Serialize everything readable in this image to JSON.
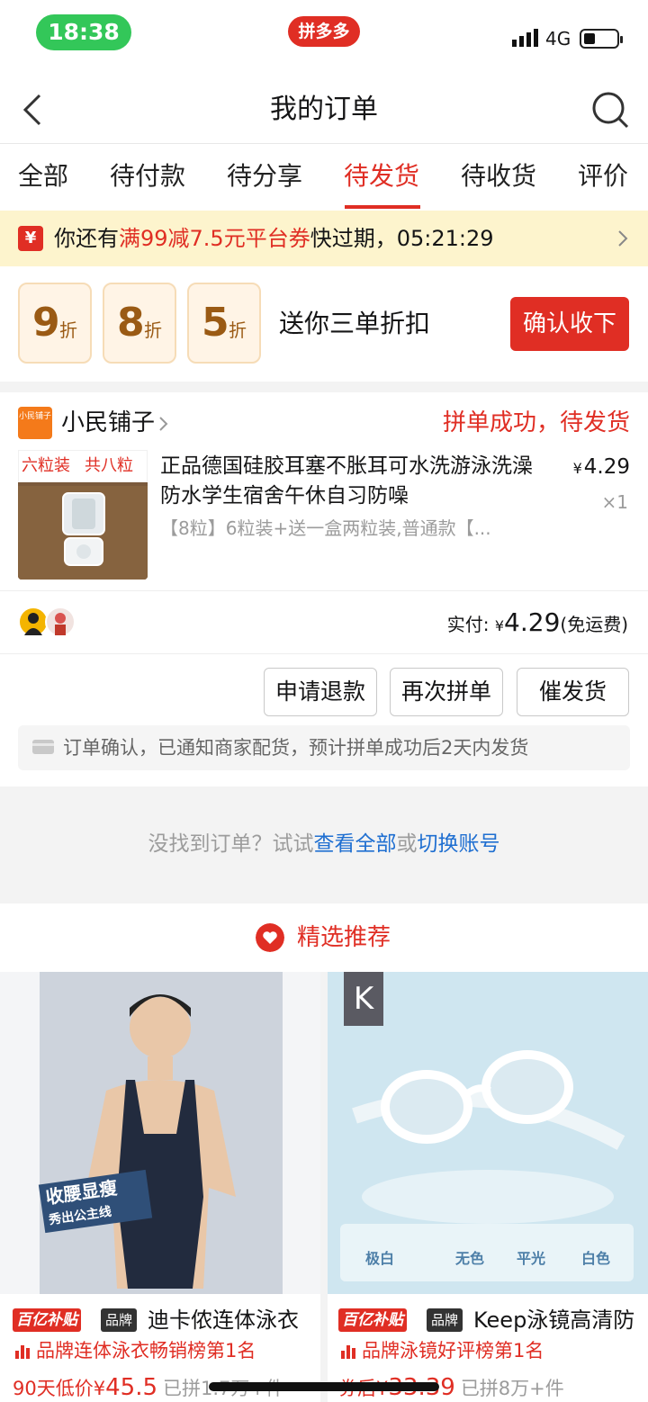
{
  "status_bar": {
    "time": "18:38",
    "app_name": "拼多多",
    "network": "4G"
  },
  "nav": {
    "title": "我的订单"
  },
  "tabs": [
    {
      "label": "全部"
    },
    {
      "label": "待付款"
    },
    {
      "label": "待分享"
    },
    {
      "label": "待发货",
      "active": true
    },
    {
      "label": "待收货"
    },
    {
      "label": "评价"
    }
  ],
  "coupon_banner": {
    "icon": "¥",
    "prefix": "你还有",
    "highlight": "满99减7.5元平台券",
    "suffix": "快过期，",
    "countdown": "05:21:29"
  },
  "discounts": {
    "cards": [
      {
        "num": "9",
        "unit": "折"
      },
      {
        "num": "8",
        "unit": "折"
      },
      {
        "num": "5",
        "unit": "折"
      }
    ],
    "label": "送你三单折扣",
    "button": "确认收下"
  },
  "order": {
    "shop_logo_text": "小民铺子",
    "shop_name": "小民铺子",
    "status": "拼单成功，待发货",
    "thumb_tags": [
      "六粒装",
      "共八粒"
    ],
    "product_title": "正品德国硅胶耳塞不胀耳可水洗游泳洗澡防水学生宿舍午休自习防噪",
    "price_symbol": "¥",
    "price": "4.29",
    "qty": "×1",
    "spec": "【8粒】6粒装+送一盒两粒装,普通款【...",
    "paid_label": "实付:",
    "paid_symbol": "¥",
    "paid_amount": "4.29",
    "shipping": "(免运费)",
    "buttons": {
      "refund": "申请退款",
      "reorder": "再次拼单",
      "urge": "催发货"
    },
    "notice": "订单确认，已通知商家配货，预计拼单成功后2天内发货"
  },
  "not_found": {
    "prefix": "没找到订单？试试",
    "link1": "查看全部",
    "mid": "或",
    "link2": "切换账号"
  },
  "recommend": {
    "title": "精选推荐",
    "products": [
      {
        "img_tag_line1": "收腰显瘦",
        "img_tag_line2": "秀出公主线",
        "subsidy_tag": "百亿补贴",
        "brand_tag": "品牌",
        "title": "迪卡侬连体泳衣",
        "rank": "品牌连体泳衣畅销榜第1名",
        "price_prefix": "90天低价",
        "price_symbol": "¥",
        "price": "45.5",
        "sold": "已拼1.7万+件"
      },
      {
        "logo": "K",
        "params": [
          "极白",
          "无色",
          "平光",
          "白色"
        ],
        "subsidy_tag": "百亿补贴",
        "brand_tag": "品牌",
        "title": "Keep泳镜高清防",
        "rank": "品牌泳镜好评榜第1名",
        "price_prefix": "券后",
        "price_symbol": "¥",
        "price": "33.39",
        "sold": "已拼8万+件"
      }
    ]
  },
  "colors": {
    "accent": "#e02e24",
    "link": "#1f6fd1",
    "coupon_bg": "#fdf4cd",
    "status_green": "#33c759"
  }
}
